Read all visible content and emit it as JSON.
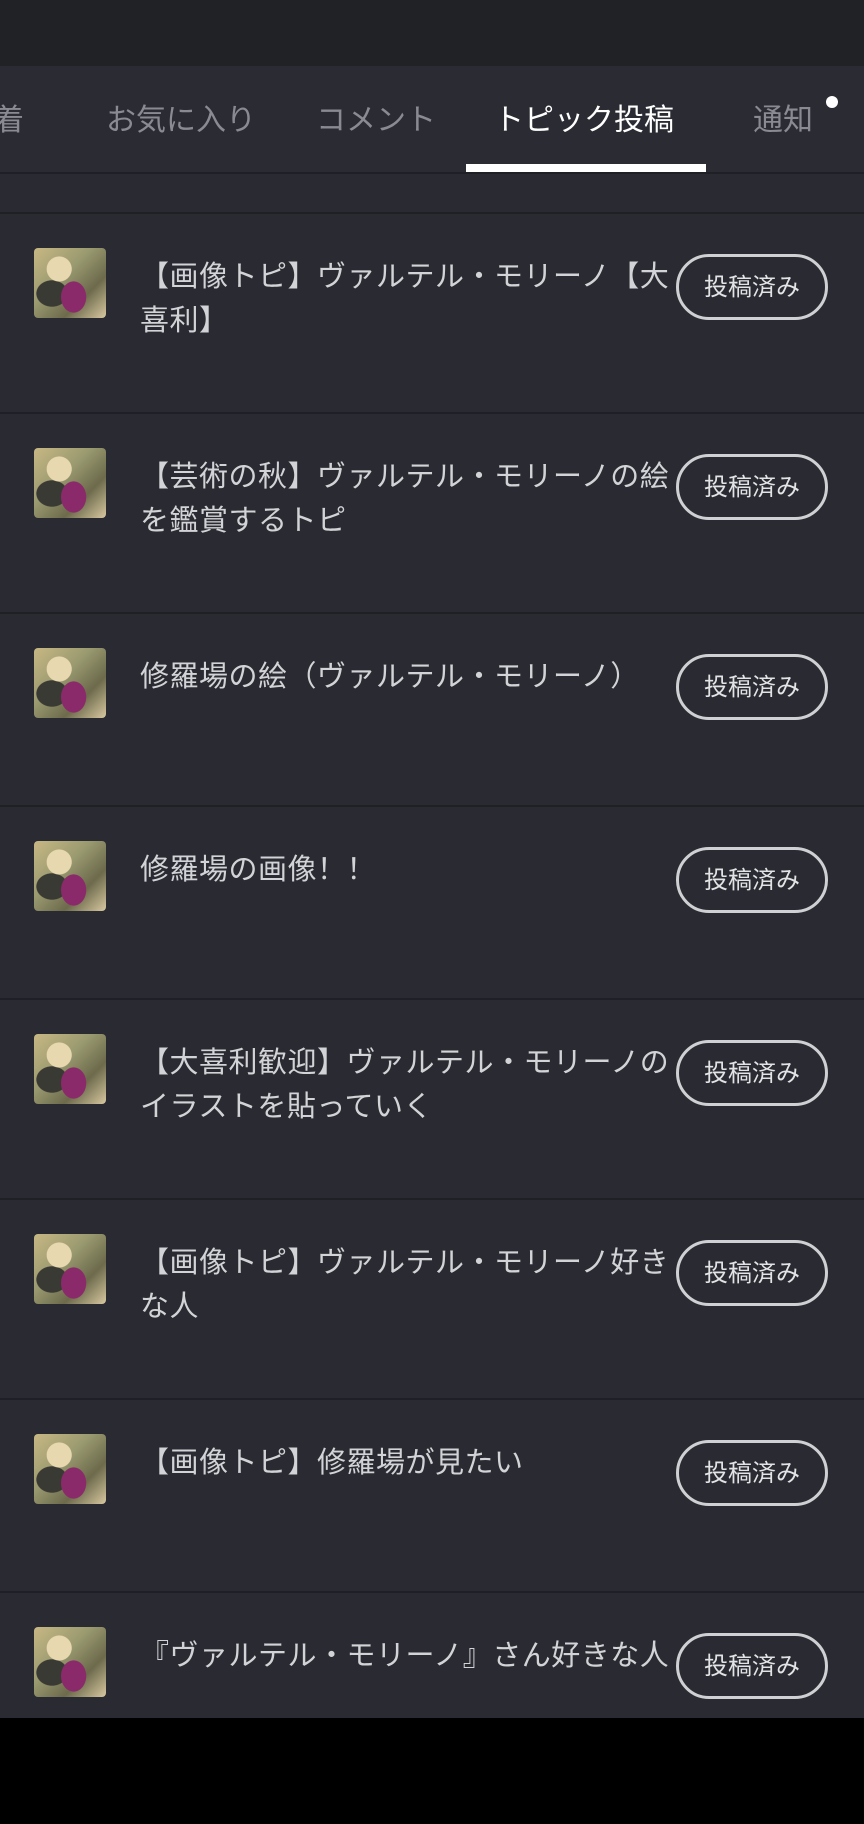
{
  "tabs": [
    {
      "label": "新着",
      "visible_label": "着"
    },
    {
      "label": "お気に入り"
    },
    {
      "label": "コメント"
    },
    {
      "label": "トピック投稿"
    },
    {
      "label": "通知"
    }
  ],
  "active_tab": "トピック投稿",
  "items": [
    {
      "title": "【画像トピ】ヴァルテル・モリーノ【大喜利】",
      "button": "投稿済み"
    },
    {
      "title": "【芸術の秋】ヴァルテル・モリーノの絵を鑑賞するトピ",
      "button": "投稿済み"
    },
    {
      "title": "修羅場の絵（ヴァルテル・モリーノ）",
      "button": "投稿済み"
    },
    {
      "title": "修羅場の画像！！",
      "button": "投稿済み"
    },
    {
      "title": "【大喜利歓迎】ヴァルテル・モリーノのイラストを貼っていく",
      "button": "投稿済み"
    },
    {
      "title": "【画像トピ】ヴァルテル・モリーノ好きな人",
      "button": "投稿済み"
    },
    {
      "title": "【画像トピ】修羅場が見たい",
      "button": "投稿済み"
    },
    {
      "title": "『ヴァルテル・モリーノ』さん好きな人",
      "button": "投稿済み"
    }
  ]
}
